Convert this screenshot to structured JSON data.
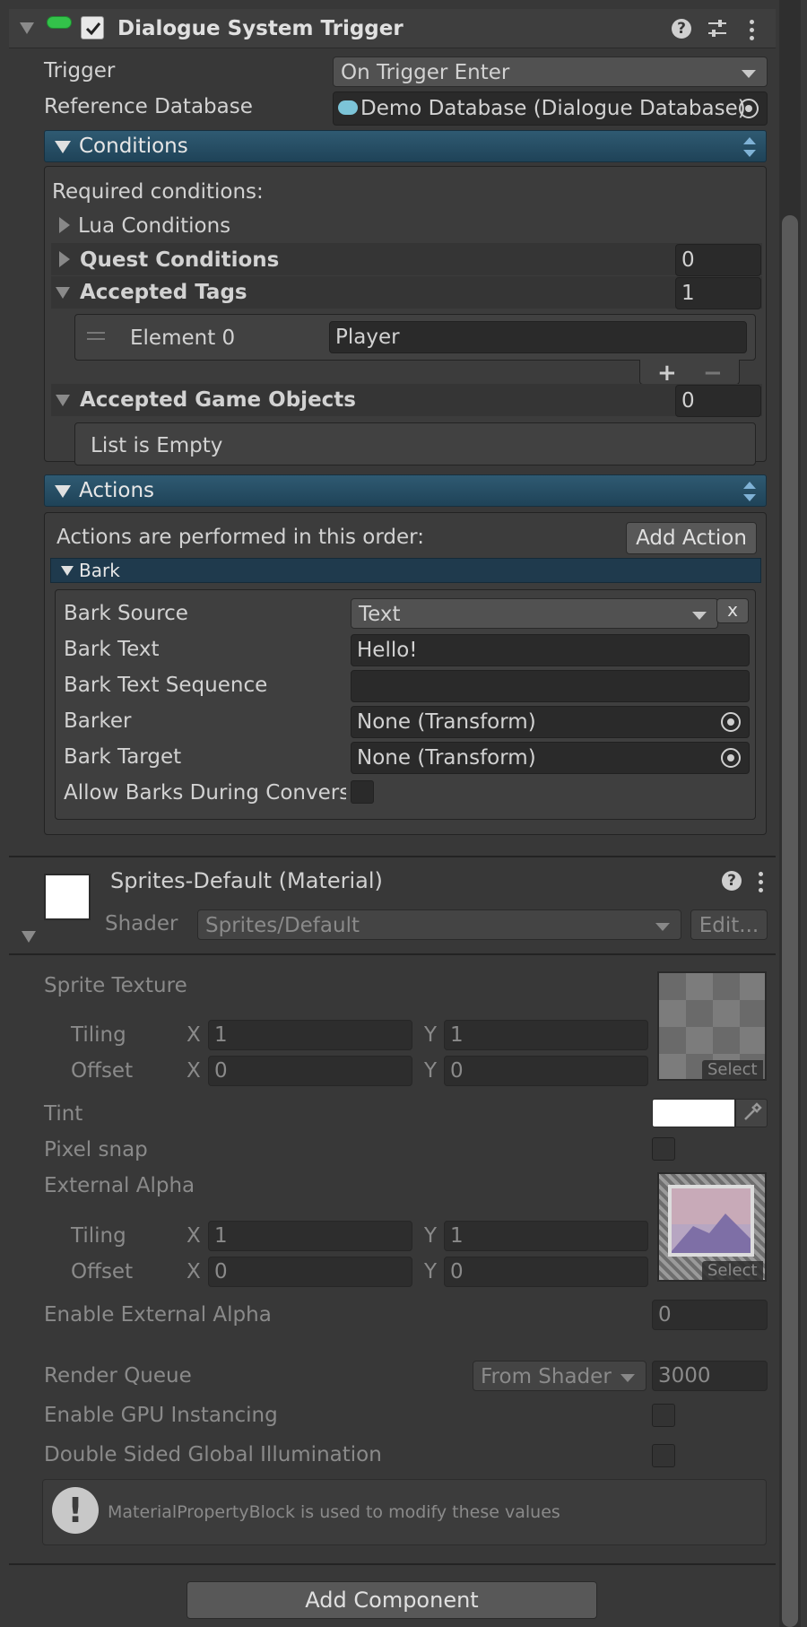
{
  "dst": {
    "title": "Dialogue System Trigger",
    "trigger_label": "Trigger",
    "trigger_value": "On Trigger Enter",
    "refdb_label": "Reference Database",
    "refdb_value": "Demo Database (Dialogue Database)",
    "conditions": {
      "header": "Conditions",
      "required": "Required conditions:",
      "lua": "Lua Conditions",
      "quest": "Quest Conditions",
      "quest_count": "0",
      "tags": "Accepted Tags",
      "tags_count": "1",
      "element0_label": "Element 0",
      "element0_value": "Player",
      "add": "+",
      "remove": "−",
      "gameobjects": "Accepted Game Objects",
      "gameobjects_count": "0",
      "empty": "List is Empty"
    },
    "actions": {
      "header": "Actions",
      "order_text": "Actions are performed in this order:",
      "add_action": "Add Action",
      "bark_header": "Bark",
      "bark_source_label": "Bark Source",
      "bark_source_value": "Text",
      "remove_x": "x",
      "bark_text_label": "Bark Text",
      "bark_text_value": "Hello!",
      "bark_seq_label": "Bark Text Sequence",
      "bark_seq_value": "",
      "barker_label": "Barker",
      "barker_value": "None (Transform)",
      "bark_target_label": "Bark Target",
      "bark_target_value": "None (Transform)",
      "allow_label": "Allow Barks During Conversa"
    }
  },
  "material": {
    "title": "Sprites-Default (Material)",
    "shader_label": "Shader",
    "shader_value": "Sprites/Default",
    "edit": "Edit...",
    "sprite_texture": "Sprite Texture",
    "tiling": "Tiling",
    "offset": "Offset",
    "x": "X",
    "y": "Y",
    "tex1": {
      "tiling_x": "1",
      "tiling_y": "1",
      "offset_x": "0",
      "offset_y": "0"
    },
    "select": "Select",
    "tint": "Tint",
    "pixel_snap": "Pixel snap",
    "external_alpha": "External Alpha",
    "tex2": {
      "tiling_x": "1",
      "tiling_y": "1",
      "offset_x": "0",
      "offset_y": "0"
    },
    "enable_external_alpha": "Enable External Alpha",
    "enable_external_alpha_value": "0",
    "render_queue": "Render Queue",
    "render_queue_mode": "From Shader",
    "render_queue_value": "3000",
    "gpu_instancing": "Enable GPU Instancing",
    "double_sided": "Double Sided Global Illumination",
    "info": "MaterialPropertyBlock is used to modify these values"
  },
  "add_component": "Add Component",
  "colors": {
    "accent_header": "#2a5068",
    "background": "#383838",
    "field": "#2a2a2a"
  }
}
